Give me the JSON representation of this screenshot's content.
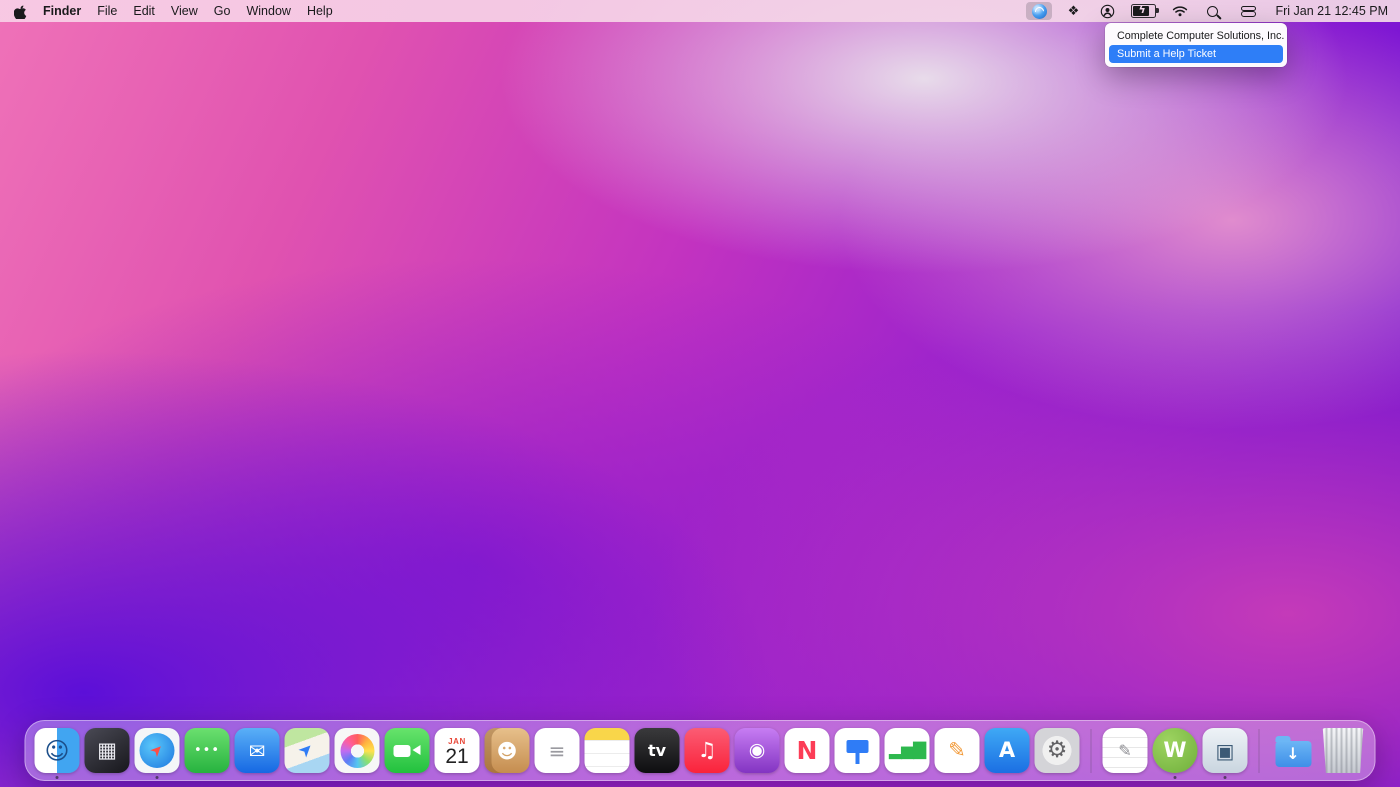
{
  "menu_bar": {
    "app_menus": [
      {
        "label": "Finder",
        "bold": true
      },
      {
        "label": "File"
      },
      {
        "label": "Edit"
      },
      {
        "label": "View"
      },
      {
        "label": "Go"
      },
      {
        "label": "Window"
      },
      {
        "label": "Help"
      }
    ],
    "status_icons": [
      {
        "name": "helpdesk-menu",
        "active": true
      },
      {
        "name": "dropbox"
      },
      {
        "name": "user-account"
      },
      {
        "name": "battery"
      },
      {
        "name": "wifi"
      },
      {
        "name": "spotlight"
      },
      {
        "name": "control-center"
      }
    ],
    "clock": "Fri Jan 21 12:45 PM"
  },
  "dropdown_menu": {
    "highlight_color": "#2e7ef7",
    "items": [
      {
        "label": "Complete Computer Solutions, Inc.",
        "highlighted": false
      },
      {
        "label": "Submit a Help Ticket",
        "highlighted": true
      }
    ]
  },
  "dock": {
    "items": [
      {
        "name": "finder",
        "label": "Finder",
        "glyph": "☺",
        "running": true
      },
      {
        "name": "launchpad",
        "label": "Launchpad",
        "glyph": "▦"
      },
      {
        "name": "safari",
        "label": "Safari",
        "glyph": "➤",
        "running": true
      },
      {
        "name": "messages",
        "label": "Messages",
        "glyph": "•••"
      },
      {
        "name": "mail",
        "label": "Mail",
        "glyph": "✉"
      },
      {
        "name": "maps",
        "label": "Maps",
        "glyph": "➤"
      },
      {
        "name": "photos",
        "label": "Photos",
        "glyph": ""
      },
      {
        "name": "facetime",
        "label": "FaceTime",
        "glyph": ""
      },
      {
        "name": "calendar",
        "label": "Calendar",
        "month": "JAN",
        "day": "21"
      },
      {
        "name": "contacts",
        "label": "Contacts",
        "glyph": "☻"
      },
      {
        "name": "reminders",
        "label": "Reminders",
        "glyph": "≡"
      },
      {
        "name": "notes",
        "label": "Notes",
        "glyph": ""
      },
      {
        "name": "appletv",
        "label": "TV",
        "glyph": "tv"
      },
      {
        "name": "music",
        "label": "Music",
        "glyph": "♫"
      },
      {
        "name": "podcasts",
        "label": "Podcasts",
        "glyph": "◉"
      },
      {
        "name": "news",
        "label": "News",
        "glyph": "N"
      },
      {
        "name": "keynote",
        "label": "Keynote",
        "glyph": ""
      },
      {
        "name": "numbers",
        "label": "Numbers",
        "glyph": "▂▅▇"
      },
      {
        "name": "pages",
        "label": "Pages",
        "glyph": "✎"
      },
      {
        "name": "appstore",
        "label": "App Store",
        "glyph": "A"
      },
      {
        "name": "sysprefs",
        "label": "System Preferences",
        "glyph": "⚙"
      },
      {
        "divider": true
      },
      {
        "name": "textedit",
        "label": "TextEdit",
        "glyph": "✎"
      },
      {
        "name": "green-w-app",
        "label": "Green W App",
        "glyph": "W",
        "running": true
      },
      {
        "name": "remote-device-app",
        "label": "Remote Device App",
        "glyph": "▣",
        "running": true
      },
      {
        "divider": true
      },
      {
        "name": "downloads",
        "label": "Downloads",
        "glyph": "↓"
      },
      {
        "name": "trash",
        "label": "Trash",
        "glyph": ""
      }
    ]
  }
}
